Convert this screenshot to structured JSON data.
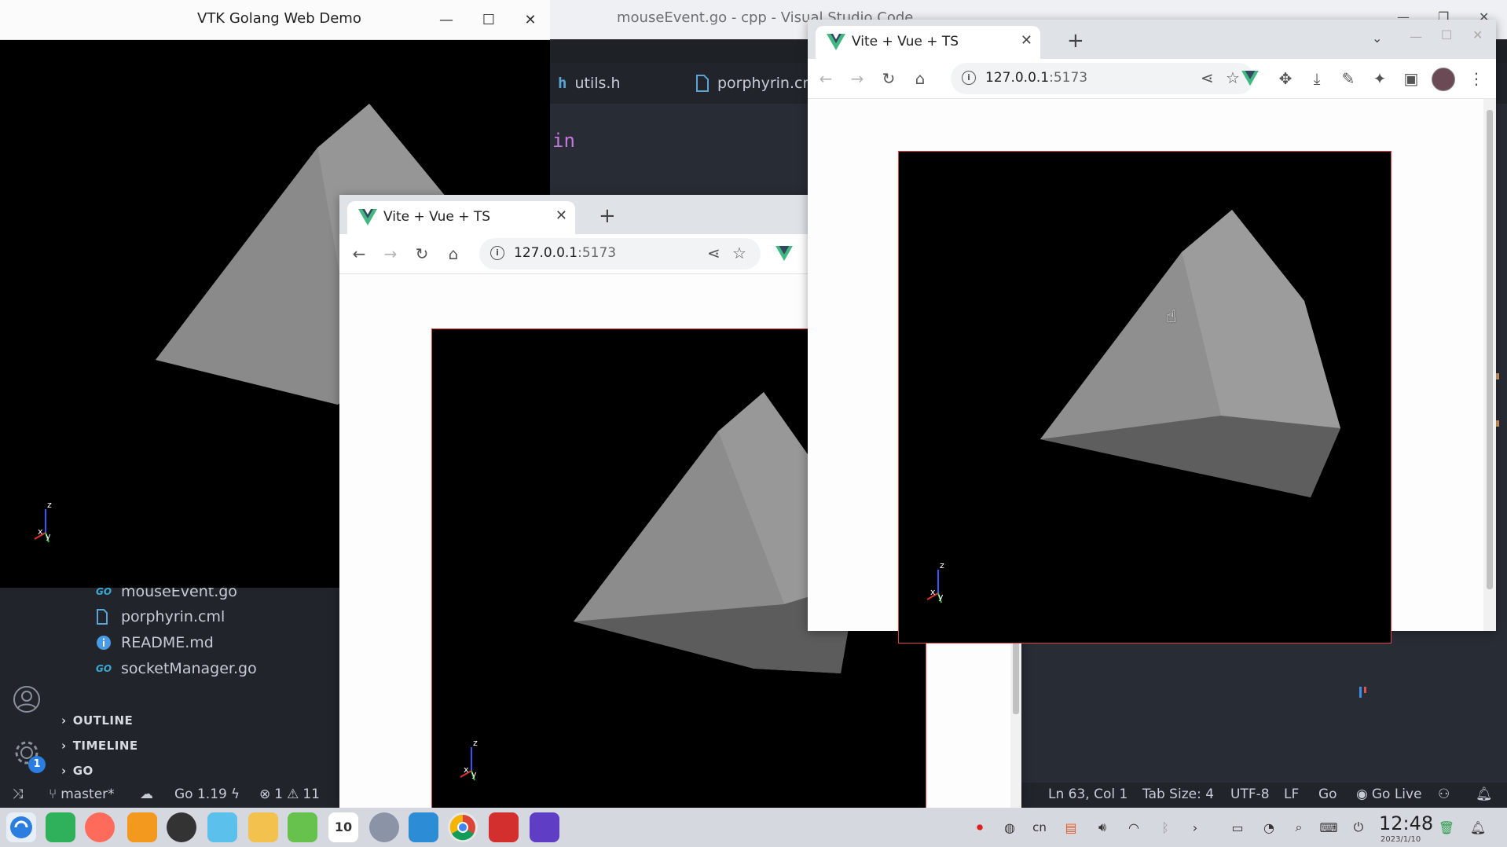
{
  "vscode": {
    "title": "mouseEvent.go - cpp - Visual Studio Code",
    "tabs": [
      {
        "icon": "h",
        "label": "utils.h"
      },
      {
        "icon": "file",
        "label": "porphyrin.cml"
      }
    ],
    "code_fragment": "in",
    "explorer_files": [
      {
        "icon": "go",
        "label": "mouseEvent.go"
      },
      {
        "icon": "file",
        "label": "porphyrin.cml"
      },
      {
        "icon": "info",
        "label": "README.md"
      },
      {
        "icon": "go",
        "label": "socketManager.go"
      }
    ],
    "sections": [
      "OUTLINE",
      "TIMELINE",
      "GO"
    ],
    "settings_badge": "1",
    "status_left": {
      "branch": "master*",
      "go_version": "Go 1.19",
      "errors": "1",
      "warnings": "11"
    },
    "status_right": {
      "position": "Ln 63, Col 1",
      "tab_size": "Tab Size: 4",
      "encoding": "UTF-8",
      "eol": "LF",
      "language": "Go",
      "live": "Go Live"
    }
  },
  "vtk_window": {
    "title": "VTK Golang Web Demo"
  },
  "browser_front": {
    "tab_title": "Vite + Vue + TS",
    "url_host": "127.0.0.1",
    "url_port": ":5173"
  },
  "browser_back": {
    "tab_title": "Vite + Vue + TS",
    "url_host": "127.0.0.1",
    "url_port": ":5173"
  },
  "axes_labels": {
    "z": "z",
    "x": "x",
    "y": "y"
  },
  "taskbar": {
    "time": "12:48",
    "date": "2023/1/10",
    "calendar_day": "10",
    "input_method": "cn"
  },
  "colors": {
    "vue_green": "#41b883",
    "vue_dark": "#34495e",
    "canvas_border": "#dd4444",
    "vscode_bg": "#282c34"
  }
}
